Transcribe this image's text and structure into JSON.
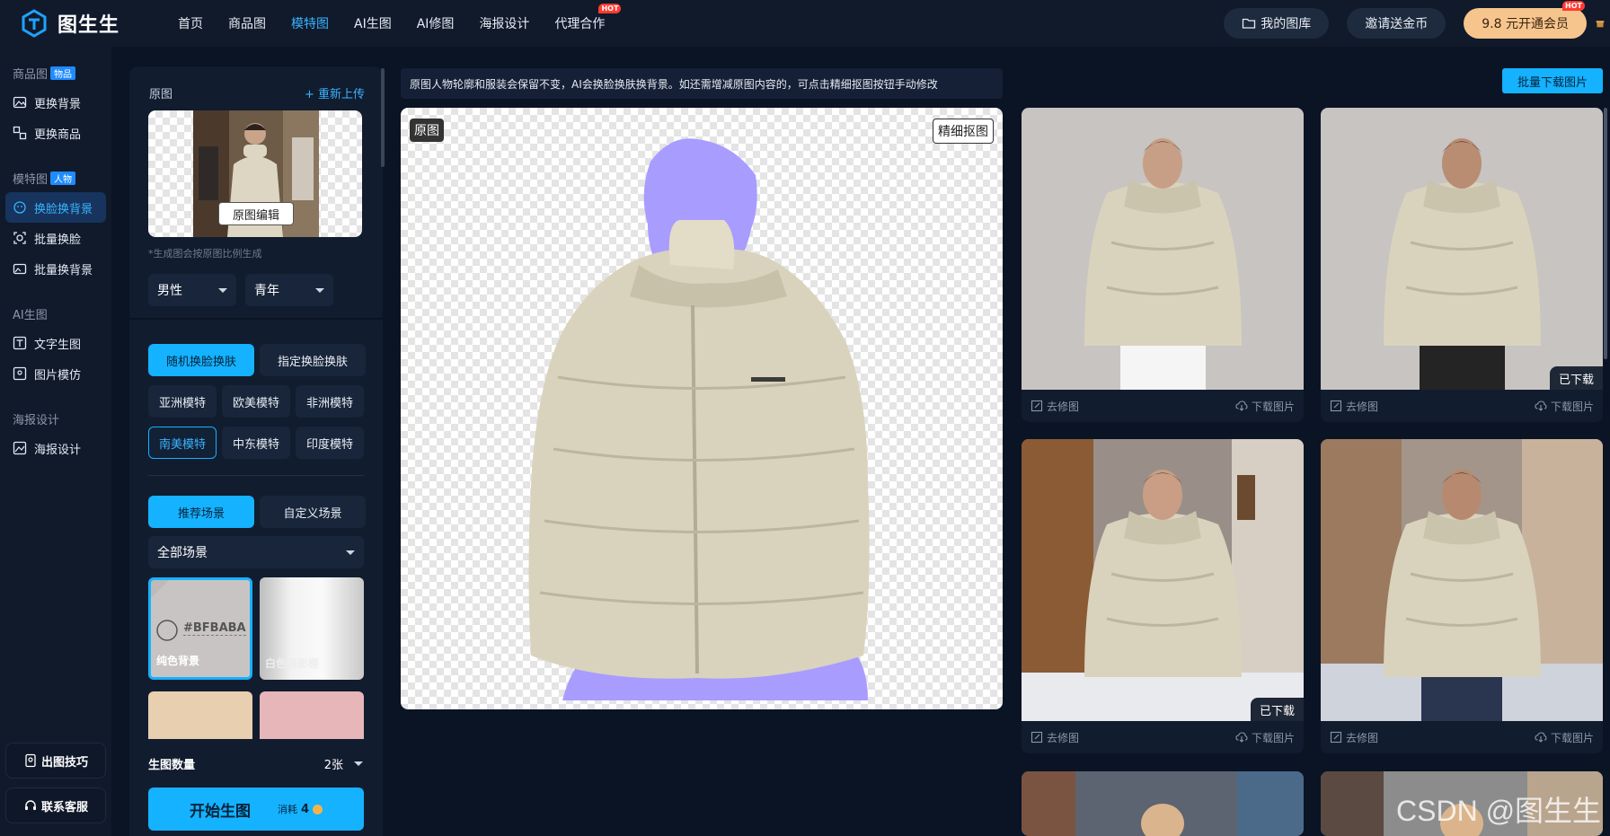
{
  "app": {
    "name": "图生生"
  },
  "nav": [
    {
      "label": "首页",
      "active": false,
      "hot": false
    },
    {
      "label": "商品图",
      "active": false,
      "hot": false
    },
    {
      "label": "模特图",
      "active": true,
      "hot": false
    },
    {
      "label": "AI生图",
      "active": false,
      "hot": false
    },
    {
      "label": "AI修图",
      "active": false,
      "hot": false
    },
    {
      "label": "海报设计",
      "active": false,
      "hot": false
    },
    {
      "label": "代理合作",
      "active": false,
      "hot": true
    }
  ],
  "hot_label": "HOT",
  "topright": {
    "gallery": "我的图库",
    "invite": "邀请送金币",
    "vip": "9.8 元开通会员"
  },
  "sidebar": {
    "sections": [
      {
        "title": "商品图",
        "tag": "物品",
        "items": [
          {
            "label": "更换背景",
            "icon": "image-swap-icon"
          },
          {
            "label": "更换商品",
            "icon": "product-swap-icon"
          }
        ]
      },
      {
        "title": "模特图",
        "tag": "人物",
        "items": [
          {
            "label": "换脸换背景",
            "icon": "face-swap-icon",
            "active": true
          },
          {
            "label": "批量换脸",
            "icon": "batch-face-icon"
          },
          {
            "label": "批量换背景",
            "icon": "batch-bg-icon"
          }
        ]
      },
      {
        "title": "AI生图",
        "tag": "",
        "items": [
          {
            "label": "文字生图",
            "icon": "text-image-icon"
          },
          {
            "label": "图片模仿",
            "icon": "image-mimic-icon"
          }
        ]
      },
      {
        "title": "海报设计",
        "tag": "",
        "items": [
          {
            "label": "海报设计",
            "icon": "poster-icon"
          }
        ]
      }
    ],
    "tips": "出图技巧",
    "support": "联系客服"
  },
  "panel": {
    "orig_label": "原图",
    "reupload": "+ 重新上传",
    "edit_orig": "原图编辑",
    "ratio_note": "*生成图会按原图比例生成",
    "gender": "男性",
    "age": "青年",
    "mode_tabs": [
      "随机换脸换肤",
      "指定换脸换肤"
    ],
    "models": [
      "亚洲模特",
      "欧美模特",
      "非洲模特",
      "南美模特",
      "中东模特",
      "印度模特"
    ],
    "selected_model": "南美模特",
    "scene_tabs": [
      "推荐场景",
      "自定义场景"
    ],
    "scene_filter": "全部场景",
    "scenes": [
      {
        "label": "纯色背景",
        "hex": "#BFBABA"
      },
      {
        "label": "白色摄影棚"
      }
    ],
    "count_label": "生图数量",
    "count_value": "2张",
    "start_label": "开始生图",
    "cost_label": "消耗",
    "cost_value": "4"
  },
  "notice": "原图人物轮廓和服装会保留不变，AI会换脸换肤换背景。如还需增减原图内容的，可点击精细抠图按钮手动修改",
  "canvas": {
    "orig_badge": "原图",
    "fine_cut": "精细抠图"
  },
  "batch_download": "批量下载图片",
  "results": [
    {
      "bg": "studio",
      "downloaded": false
    },
    {
      "bg": "studio",
      "downloaded": true
    },
    {
      "bg": "street",
      "downloaded": true
    },
    {
      "bg": "street",
      "downloaded": false
    }
  ],
  "result_actions": {
    "retouch": "去修图",
    "download": "下载图片",
    "downloaded": "已下载"
  },
  "watermark": "CSDN @图生生",
  "colors": {
    "accent": "#14b2ff",
    "bg": "#0b1424",
    "panel": "#111c2e",
    "mask": "#a99cff",
    "jacket": "#d9d3bd"
  }
}
